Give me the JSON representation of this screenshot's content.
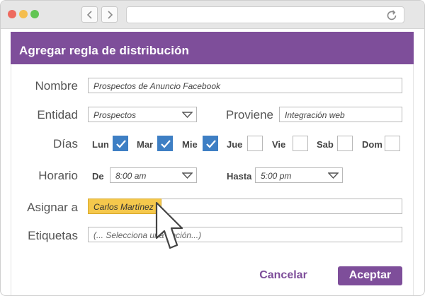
{
  "dialog": {
    "title": "Agregar regla de distribución",
    "accent_color": "#7e4e9a",
    "check_color": "#3e7fc4",
    "highlight_color": "#f5c84c"
  },
  "form": {
    "nombre": {
      "label": "Nombre",
      "value": "Prospectos de Anuncio Facebook"
    },
    "entidad": {
      "label": "Entidad",
      "value": "Prospectos"
    },
    "proviene": {
      "label": "Proviene",
      "value": "Integración web"
    },
    "dias": {
      "label": "Días",
      "items": [
        {
          "label": "Lun",
          "checked": true
        },
        {
          "label": "Mar",
          "checked": true
        },
        {
          "label": "Mie",
          "checked": true
        },
        {
          "label": "Jue",
          "checked": false
        },
        {
          "label": "Vie",
          "checked": false
        },
        {
          "label": "Sab",
          "checked": false
        },
        {
          "label": "Dom",
          "checked": false
        }
      ]
    },
    "horario": {
      "label": "Horario",
      "de_label": "De",
      "de_value": "8:00 am",
      "hasta_label": "Hasta",
      "hasta_value": "5:00 pm"
    },
    "asignar": {
      "label": "Asignar a",
      "value": "Carlos Martínez"
    },
    "etiquetas": {
      "label": "Etiquetas",
      "placeholder": "(... Selecciona una opción...)"
    }
  },
  "actions": {
    "cancel": "Cancelar",
    "accept": "Aceptar"
  },
  "icons": {
    "back": "chevron-left-icon",
    "forward": "chevron-right-icon",
    "reload": "reload-icon",
    "dropdown": "caret-down-icon",
    "check": "check-icon",
    "cursor": "mouse-pointer-icon"
  }
}
